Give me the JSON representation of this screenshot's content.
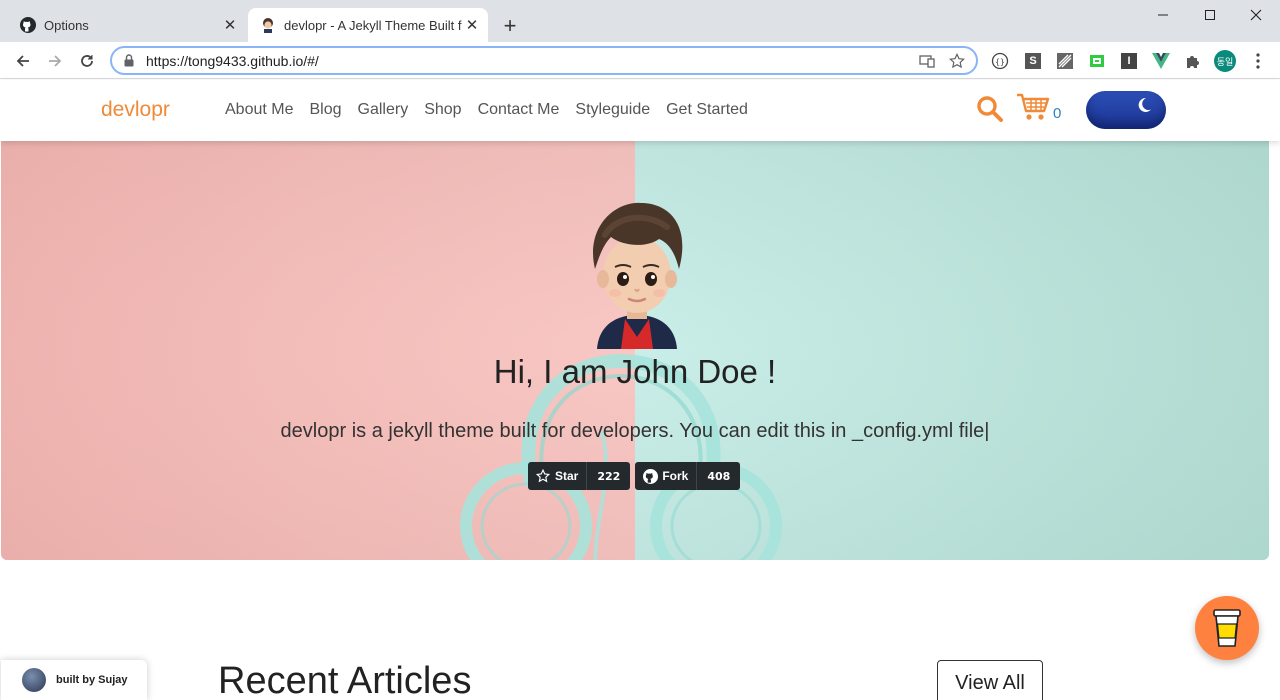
{
  "browser": {
    "tabs": [
      {
        "title": "Options",
        "active": false,
        "icon": "github-icon"
      },
      {
        "title": "devlopr - A Jekyll Theme Built f",
        "active": true,
        "icon": "avatar-favicon"
      }
    ],
    "url": "https://tong9433.github.io/#/",
    "extensions": [
      "devtools-icon",
      "s-extension-icon",
      "tool-extension-icon",
      "green-extension-icon",
      "i-extension-icon",
      "vue-icon",
      "puzzle-icon"
    ],
    "profile_label": "동일"
  },
  "site": {
    "brand": "devlopr",
    "nav": [
      "About Me",
      "Blog",
      "Gallery",
      "Shop",
      "Contact Me",
      "Styleguide",
      "Get Started"
    ],
    "cart_count": "0",
    "accent": "#f08a36"
  },
  "hero": {
    "title": "Hi, I am John Doe !",
    "subtitle": "devlopr is a jekyll theme built for developers. You can edit this in _config.yml file|",
    "star_label": "Star",
    "star_count": "222",
    "fork_label": "Fork",
    "fork_count": "408"
  },
  "section": {
    "recent_title": "Recent Articles",
    "view_all": "View All"
  },
  "footer": {
    "built_by": "built by Sujay"
  }
}
